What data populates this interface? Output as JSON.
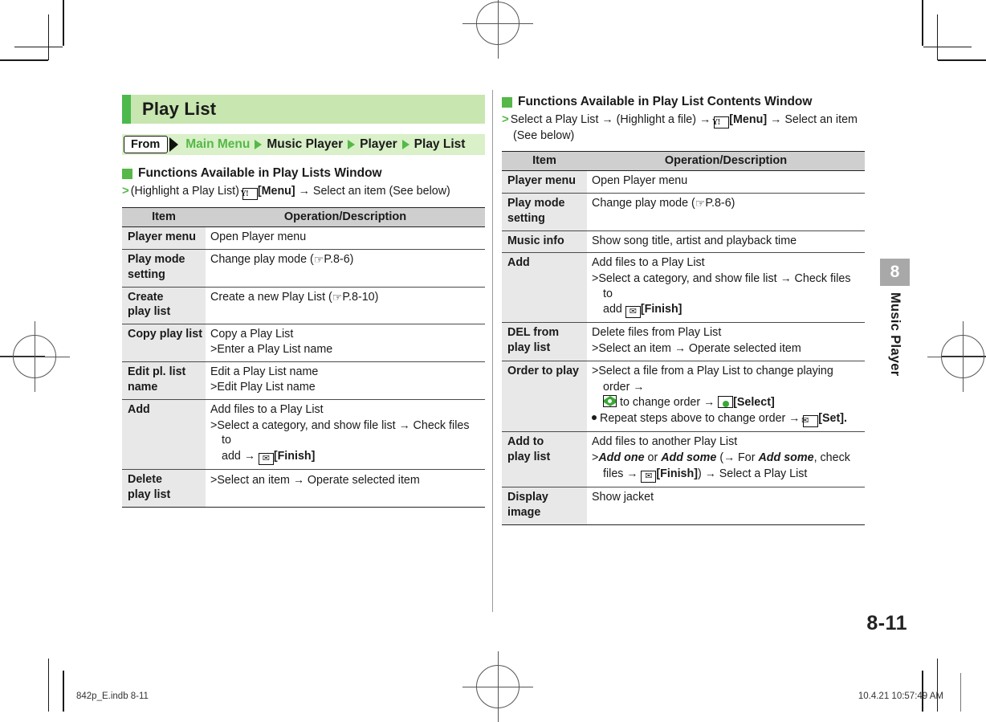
{
  "document": {
    "page_number": "8-11",
    "chapter_number": "8",
    "chapter_name": "Music Player",
    "footer_left": "842p_E.indb   8-11",
    "footer_right": "10.4.21   10:57:49 AM"
  },
  "section": {
    "title": "Play List"
  },
  "breadcrumb": {
    "from_label": "From",
    "items": [
      {
        "text": "Main Menu",
        "color": "green"
      },
      {
        "text": "Music Player",
        "color": "dark"
      },
      {
        "text": "Player",
        "color": "dark"
      },
      {
        "text": "Play List",
        "color": "dark"
      }
    ],
    "accent_green": "#55b848"
  },
  "left_column": {
    "heading": "Functions Available in Play Lists Window",
    "steps_line1_pre": "(Highlight a Play List) ",
    "steps_key": "Y7",
    "steps_line1_post": "[Menu]",
    "steps_line1_tail": " → Select an item (See below)",
    "table": {
      "headers": [
        "Item",
        "Operation/Description"
      ],
      "rows": [
        {
          "item": "Player menu",
          "lines": [
            {
              "text": "Open Player menu"
            }
          ]
        },
        {
          "item": "Play mode\nsetting",
          "lines": [
            {
              "text": "Change play mode (",
              "ref": "P.8-6",
              "suffix": ")"
            }
          ]
        },
        {
          "item": "Create\nplay list",
          "lines": [
            {
              "text": "Create a new Play List (",
              "ref": "P.8-10",
              "suffix": ")"
            }
          ]
        },
        {
          "item": "Copy play list",
          "lines": [
            {
              "text": "Copy a Play List"
            },
            {
              "gt": true,
              "text": "Enter a Play List name"
            }
          ]
        },
        {
          "item": "Edit pl. list\nname",
          "lines": [
            {
              "text": "Edit a Play List name"
            },
            {
              "gt": true,
              "text": "Edit Play List name"
            }
          ]
        },
        {
          "item": "Add",
          "lines": [
            {
              "text": "Add files to a Play List"
            },
            {
              "gt": true,
              "text": "Select a category, and show file list → Check files to add → [Finish]"
            }
          ]
        },
        {
          "item": "Delete\nplay list",
          "lines": [
            {
              "gt": true,
              "text": "Select an item → Operate selected item"
            }
          ]
        }
      ]
    }
  },
  "right_column": {
    "heading": "Functions Available in Play List Contents Window",
    "steps_pre": "Select a Play List → (Highlight a file) → ",
    "steps_key": "Y7",
    "steps_menu": "[Menu]",
    "steps_post": " → Select an item",
    "steps_line2": "(See below)",
    "table": {
      "headers": [
        "Item",
        "Operation/Description"
      ],
      "rows": [
        {
          "item": "Player menu",
          "lines": [
            {
              "text": "Open Player menu"
            }
          ]
        },
        {
          "item": "Play mode\nsetting",
          "lines": [
            {
              "text": "Change play mode (",
              "ref": "P.8-6",
              "suffix": ")"
            }
          ]
        },
        {
          "item": "Music info",
          "lines": [
            {
              "text": "Show song title, artist and playback time"
            }
          ]
        },
        {
          "item": "Add",
          "lines": [
            {
              "text": "Add files to a Play List"
            },
            {
              "gt": true,
              "text": "Select a category, and show file list → Check files to add [Finish]"
            }
          ]
        },
        {
          "item": "DEL from\nplay list",
          "lines": [
            {
              "text": "Delete files from Play List"
            },
            {
              "gt": true,
              "text": "Select an item → Operate selected item"
            }
          ]
        },
        {
          "item": "Order to play",
          "lines": [
            {
              "gt": true,
              "text": "Select a file from a Play List to change playing order → [nav] to change order → [Select]"
            },
            {
              "dot": true,
              "text": "Repeat steps above to change order → [Set]."
            }
          ]
        },
        {
          "item": "Add to\nplay list",
          "lines": [
            {
              "text": "Add files to another Play List"
            },
            {
              "gt": true,
              "text": "Add one or Add some (→ For Add some, check files → [Finish]) → Select a Play List"
            }
          ]
        },
        {
          "item": "Display image",
          "lines": [
            {
              "text": "Show jacket"
            }
          ]
        }
      ]
    }
  },
  "labels": {
    "menu_key": "[Menu]",
    "finish_key": "[Finish]",
    "select_key": "[Select]",
    "set_key": "[Set].",
    "add_one": "Add one",
    "add_some": "Add some"
  }
}
